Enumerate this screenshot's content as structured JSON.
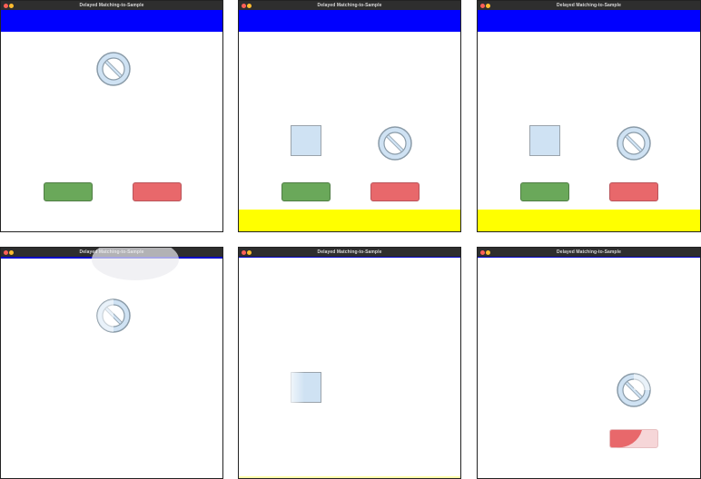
{
  "window_title": "Delayed Matching-to-Sample",
  "colors": {
    "top_band": "#0000ff",
    "bottom_band": "#ffff00",
    "stimulus_fill": "#cfe2f3",
    "green_button": "#6aa85a",
    "red_button": "#e8686b"
  },
  "stimuli": {
    "sample": "no-entry-icon",
    "comparison_a": "square-icon",
    "comparison_b": "no-entry-icon"
  }
}
